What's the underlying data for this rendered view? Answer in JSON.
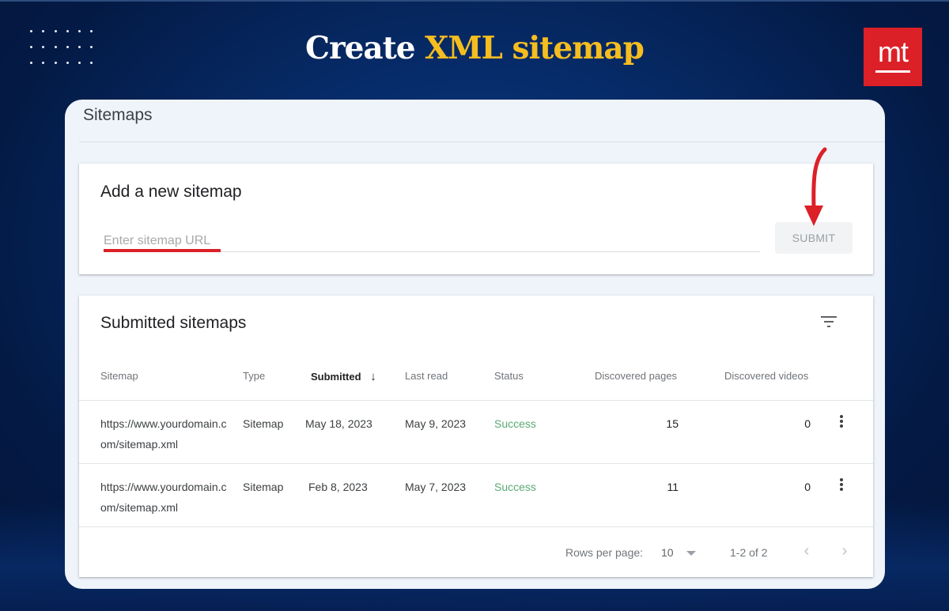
{
  "banner": {
    "headline_prefix": "Create",
    "headline_accent": "XML sitemap",
    "logo_text": "mt",
    "accent_color": "#f5bd1f",
    "logo_color": "#dc2027"
  },
  "page": {
    "title": "Sitemaps"
  },
  "add_sitemap": {
    "title": "Add a new sitemap",
    "input_placeholder": "Enter sitemap URL",
    "input_value": "",
    "submit_label": "SUBMIT",
    "annotation": "red-arrow-pointing-to-submit"
  },
  "submitted": {
    "title": "Submitted sitemaps",
    "filter_icon": "filter-icon",
    "columns": [
      "Sitemap",
      "Type",
      "Submitted",
      "Last read",
      "Status",
      "Discovered pages",
      "Discovered videos"
    ],
    "sorted_column": "Submitted",
    "sort_direction": "descending",
    "rows": [
      {
        "sitemap": "https://www.yourdomain.com/sitemap.xml",
        "type": "Sitemap",
        "submitted": "May 18, 2023",
        "last_read": "May 9, 2023",
        "status": "Success",
        "pages": "15",
        "videos": "0"
      },
      {
        "sitemap": "https://www.yourdomain.com/sitemap.xml",
        "type": "Sitemap",
        "submitted": "Feb 8, 2023",
        "last_read": "May 7, 2023",
        "status": "Success",
        "pages": "11",
        "videos": "0"
      }
    ],
    "status_color": "#5aa972"
  },
  "pagination": {
    "rows_per_page_label": "Rows per page:",
    "rows_per_page_value": "10",
    "range_text": "1-2 of 2",
    "prev_icon": "‹",
    "next_icon": "›"
  }
}
